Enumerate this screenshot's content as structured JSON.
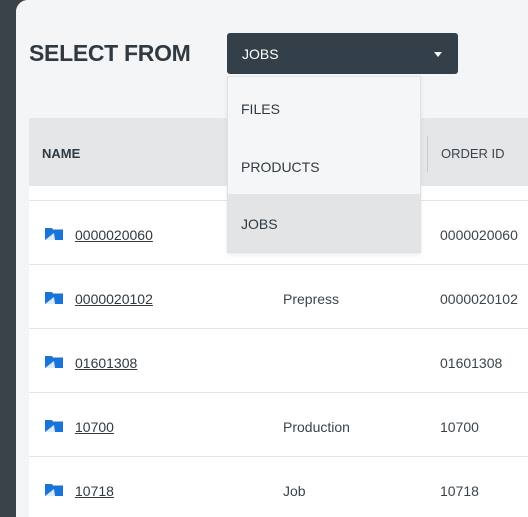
{
  "header": {
    "title": "SELECT FROM"
  },
  "select": {
    "value": "JOBS",
    "options": [
      "FILES",
      "PRODUCTS",
      "JOBS"
    ],
    "selected_index": 2
  },
  "table": {
    "columns": {
      "name": "NAME",
      "order_id": "ORDER ID"
    },
    "rows": [
      {
        "name": "0000020060",
        "type": "",
        "order_id": "0000020060"
      },
      {
        "name": "0000020102",
        "type": "Prepress",
        "order_id": "0000020102"
      },
      {
        "name": "01601308",
        "type": "",
        "order_id": "01601308"
      },
      {
        "name": "10700",
        "type": "Production",
        "order_id": "10700"
      },
      {
        "name": "10718",
        "type": "Job",
        "order_id": "10718"
      }
    ]
  },
  "colors": {
    "background": "#3a4349",
    "select_bg": "#344049",
    "folder_icon": "#1a73d9",
    "selected_option_bg": "#e2e4e6"
  },
  "icons": {
    "row_icon": "folder-icon",
    "select_caret": "caret-down-icon"
  }
}
